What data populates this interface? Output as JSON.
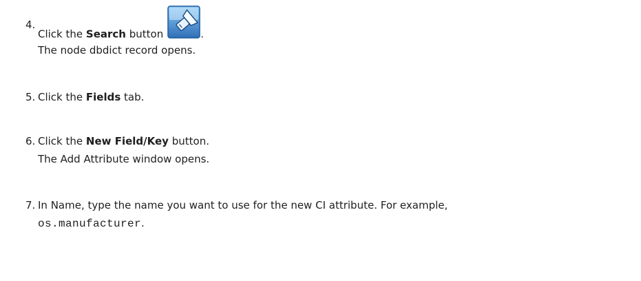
{
  "steps": [
    {
      "number": "4.",
      "pre": "Click the ",
      "bold": "Search",
      "post": " button",
      "after_icon": ".",
      "icon": "search-flashlight-icon",
      "result": "The node dbdict record opens."
    },
    {
      "number": "5.",
      "pre": "Click the ",
      "bold": "Fields",
      "post": " tab."
    },
    {
      "number": "6.",
      "pre": "Click the ",
      "bold": "New Field/Key",
      "post": " button.",
      "result": "The Add Attribute window opens."
    },
    {
      "number": "7.",
      "text": "In Name, type the name you want to use for the new CI attribute. For example,",
      "code": "os.manufacturer",
      "code_suffix": "."
    }
  ],
  "colors": {
    "text": "#1e1e1e",
    "icon_blue_dark": "#2f6fb8",
    "icon_blue_light": "#6fb6ee"
  }
}
